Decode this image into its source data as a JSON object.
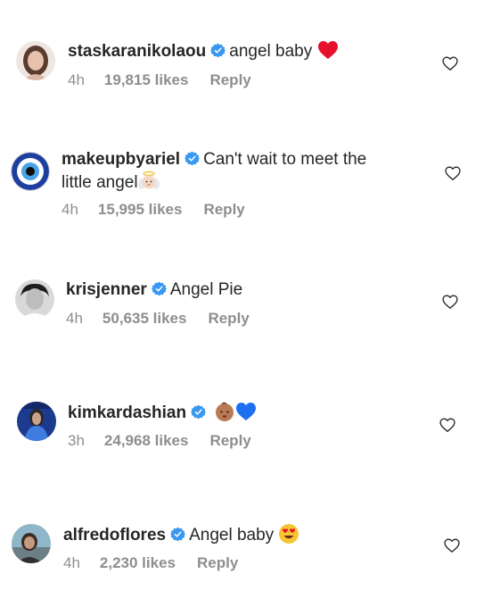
{
  "colors": {
    "text": "#262626",
    "meta": "#8e8e8e",
    "verified": "#3897f0"
  },
  "comments": [
    {
      "username": "staskaranikolaou",
      "verified": true,
      "text": "angel baby",
      "emojis": [
        "red-heart-emoji"
      ],
      "time": "4h",
      "likes": "19,815 likes",
      "reply": "Reply",
      "avatar_icon": "woman-portrait-avatar"
    },
    {
      "username": "makeupbyariel",
      "verified": true,
      "text": "Can't wait to meet the little angel",
      "emojis": [
        "baby-angel-emoji"
      ],
      "time": "4h",
      "likes": "15,995 likes",
      "reply": "Reply",
      "avatar_icon": "evil-eye-avatar"
    },
    {
      "username": "krisjenner",
      "verified": true,
      "text": "Angel Pie",
      "emojis": [],
      "time": "4h",
      "likes": "50,635 likes",
      "reply": "Reply",
      "avatar_icon": "bw-portrait-avatar"
    },
    {
      "username": "kimkardashian",
      "verified": true,
      "text": "",
      "emojis": [
        "baby-emoji",
        "blue-heart-emoji"
      ],
      "time": "3h",
      "likes": "24,968 likes",
      "reply": "Reply",
      "avatar_icon": "blue-outfit-avatar"
    },
    {
      "username": "alfredoflores",
      "verified": true,
      "text": "Angel baby",
      "emojis": [
        "heart-eyes-emoji"
      ],
      "time": "4h",
      "likes": "2,230 likes",
      "reply": "Reply",
      "avatar_icon": "outdoor-portrait-avatar"
    }
  ]
}
